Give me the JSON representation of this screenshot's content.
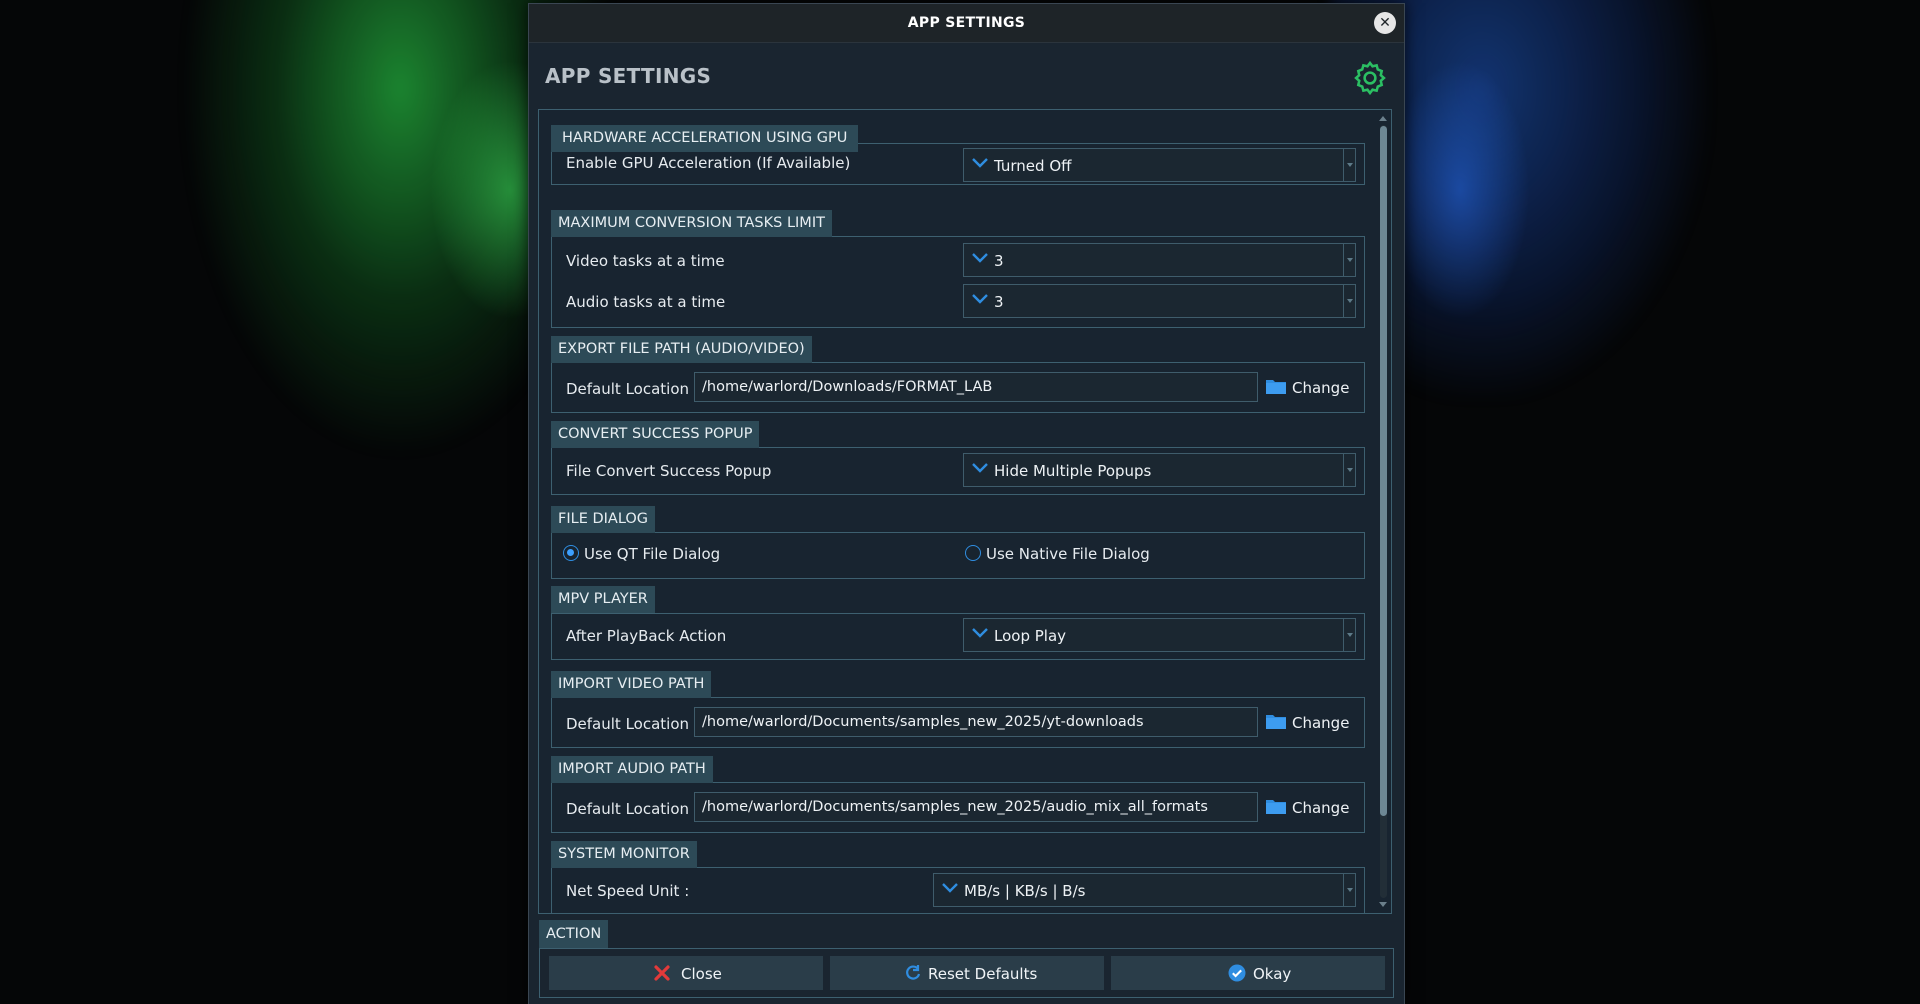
{
  "window": {
    "title": "APP SETTINGS",
    "close_glyph": "✕"
  },
  "header": {
    "title": "APP SETTINGS",
    "icon": "gear-icon",
    "accent": "#2bbf63"
  },
  "sections": {
    "gpu": {
      "title": "HARDWARE ACCELERATION USING GPU",
      "label": "Enable GPU Acceleration (If Available)",
      "value": "Turned Off"
    },
    "tasks": {
      "title": "MAXIMUM CONVERSION TASKS LIMIT",
      "video_label": "Video tasks at a time",
      "video_value": "3",
      "audio_label": "Audio tasks at a time",
      "audio_value": "3"
    },
    "export": {
      "title": "EXPORT FILE PATH (AUDIO/VIDEO)",
      "label": "Default Location",
      "path": "/home/warlord/Downloads/FORMAT_LAB",
      "button": "Change"
    },
    "popup": {
      "title": "CONVERT SUCCESS POPUP",
      "label": "File Convert Success Popup",
      "value": "Hide Multiple Popups"
    },
    "file_dialog": {
      "title": "FILE DIALOG",
      "option_qt": "Use QT File Dialog",
      "option_native": "Use Native File Dialog",
      "selected": "Use QT File Dialog"
    },
    "mpv": {
      "title": "MPV PLAYER",
      "label": "After PlayBack Action",
      "value": "Loop Play"
    },
    "import_video": {
      "title": "IMPORT VIDEO PATH",
      "label": "Default Location",
      "path": "/home/warlord/Documents/samples_new_2025/yt-downloads",
      "button": "Change"
    },
    "import_audio": {
      "title": "IMPORT AUDIO PATH",
      "label": "Default Location",
      "path": "/home/warlord/Documents/samples_new_2025/audio_mix_all_formats",
      "button": "Change"
    },
    "monitor": {
      "title": "SYSTEM MONITOR",
      "label": "Net Speed Unit :",
      "value": "MB/s | KB/s | B/s"
    }
  },
  "action": {
    "title": "ACTION",
    "close": "Close",
    "reset": "Reset Defaults",
    "okay": "Okay"
  },
  "colors": {
    "accent_blue": "#2f8de0",
    "close_red": "#e23a3a",
    "section_header_bg": "#2d4a57",
    "panel_bg": "#182430"
  }
}
